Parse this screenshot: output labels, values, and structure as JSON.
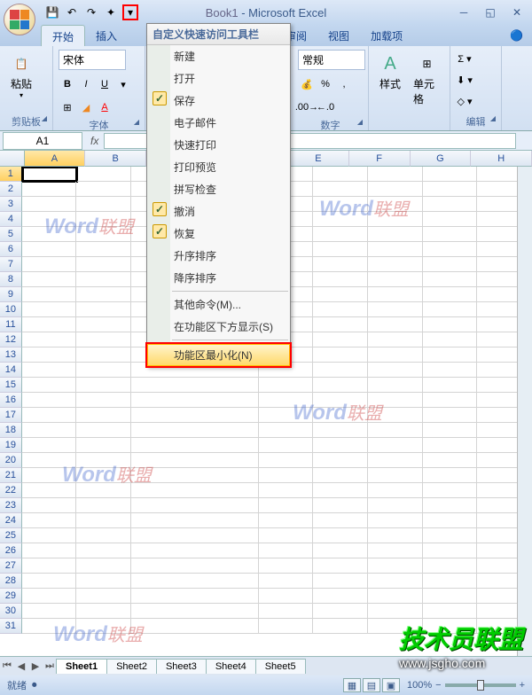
{
  "title": {
    "doc": "Book1",
    "app": "Microsoft Excel"
  },
  "tabs": [
    "开始",
    "插入",
    "审阅",
    "视图",
    "加载项"
  ],
  "ribbon": {
    "clipboard": {
      "paste": "粘贴",
      "label": "剪贴板"
    },
    "font": {
      "name": "宋体",
      "label": "字体"
    },
    "number": {
      "format": "常规",
      "label": "数字"
    },
    "styles": {
      "style": "样式",
      "cell": "单元格"
    },
    "editing": {
      "label": "编辑"
    }
  },
  "name_box": "A1",
  "columns": [
    "A",
    "B",
    "E",
    "F",
    "G",
    "H"
  ],
  "sheets": [
    "Sheet1",
    "Sheet2",
    "Sheet3",
    "Sheet4",
    "Sheet5"
  ],
  "status": {
    "ready": "就绪",
    "zoom": "100%"
  },
  "dropdown": {
    "title": "自定义快速访问工具栏",
    "items": [
      {
        "label": "新建"
      },
      {
        "label": "打开"
      },
      {
        "label": "保存",
        "checked": true
      },
      {
        "label": "电子邮件"
      },
      {
        "label": "快速打印"
      },
      {
        "label": "打印预览"
      },
      {
        "label": "拼写检查"
      },
      {
        "label": "撤消",
        "checked": true
      },
      {
        "label": "恢复",
        "checked": true
      },
      {
        "label": "升序排序"
      },
      {
        "label": "降序排序"
      }
    ],
    "more": "其他命令(M)...",
    "below": "在功能区下方显示(S)",
    "minimize": "功能区最小化(N)"
  },
  "watermarks": {
    "word": "Word",
    "lm": "联盟",
    "tech": "技术员联盟",
    "url": "www.jsgho.com"
  }
}
